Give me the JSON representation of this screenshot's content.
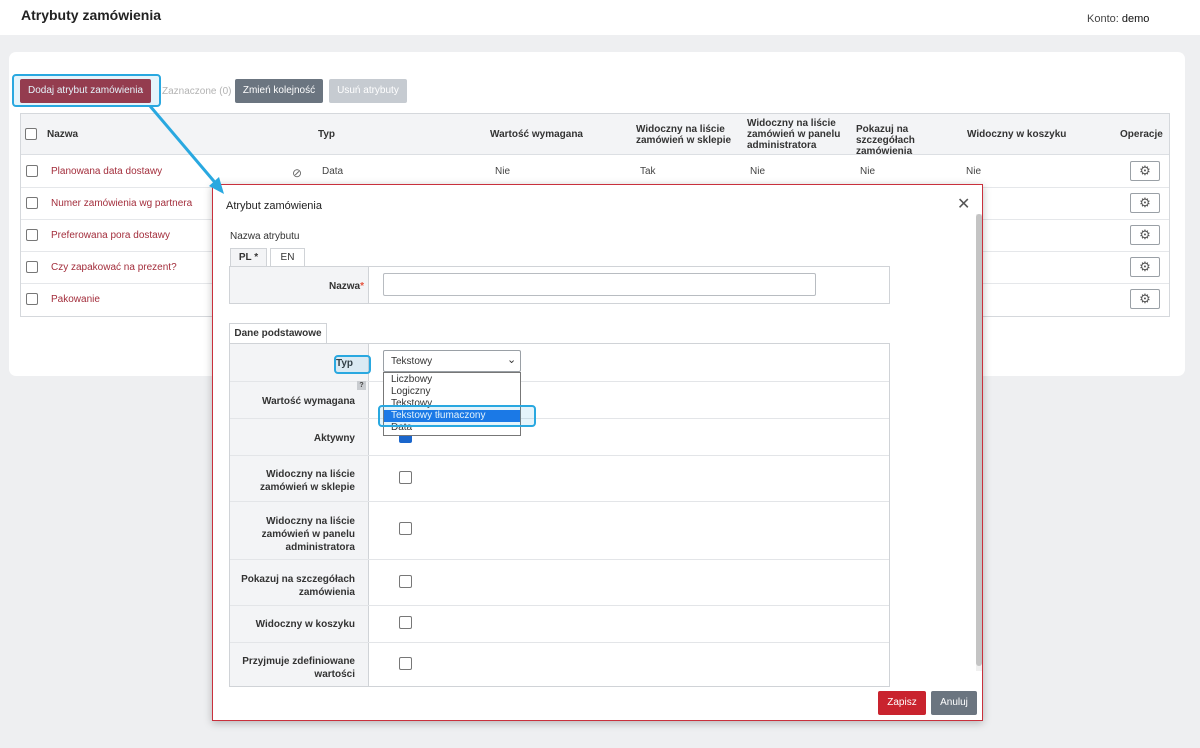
{
  "header": {
    "title": "Atrybuty zamówienia",
    "account_label": "Konto:",
    "account_value": "demo"
  },
  "toolbar": {
    "add_label": "Dodaj atrybut zamówienia",
    "selected_label": "Zaznaczone (0)",
    "reorder_label": "Zmień kolejność",
    "remove_label": "Usuń atrybuty"
  },
  "table": {
    "columns": [
      "Nazwa",
      "Typ",
      "Wartość wymagana",
      "Widoczny na liście zamówień w sklepie",
      "Widoczny na liście zamówień w panelu administratora",
      "Pokazuj na szczegółach zamówienia",
      "Widoczny w koszyku",
      "Operacje"
    ],
    "rows": [
      {
        "name": "Planowana data dostawy",
        "type": "Data",
        "required": "Nie",
        "shop_list": "Tak",
        "admin_list": "Nie",
        "details": "Nie",
        "cart": "Nie"
      },
      {
        "name": "Numer zamówienia wg partnera"
      },
      {
        "name": "Preferowana pora dostawy"
      },
      {
        "name": "Czy zapakować na prezent?"
      },
      {
        "name": "Pakowanie"
      }
    ],
    "ops_icon": "gear-icon",
    "ban_icon": "ban-icon"
  },
  "modal": {
    "title": "Atrybut zamówienia",
    "close_icon": "close-icon",
    "attr_name_label": "Nazwa atrybutu",
    "lang_tabs": [
      "PL *",
      "EN"
    ],
    "name_label": "Nazwa",
    "name_value": "",
    "section_tab": "Dane podstawowe",
    "fields": {
      "type": "Typ",
      "required": "Wartość wymagana",
      "active": "Aktywny",
      "shop_list": "Widoczny na liście zamówień w sklepie",
      "admin_list": "Widoczny na liście zamówień w panelu administratora",
      "details": "Pokazuj na szczegółach zamówienia",
      "cart": "Widoczny w koszyku",
      "predefined": "Przyjmuje zdefiniowane wartości"
    },
    "help_glyph": "?",
    "type_select": {
      "value": "Tekstowy",
      "options": [
        "Liczbowy",
        "Logiczny",
        "Tekstowy",
        "Tekstowy tłumaczony",
        "Data"
      ],
      "highlighted": "Tekstowy tłumaczony"
    },
    "active_checked": true,
    "save_label": "Zapisz",
    "cancel_label": "Anuluj"
  },
  "colors": {
    "accent": "#a32e3c",
    "highlight": "#29a8e0",
    "option_active": "#1a73e8",
    "save": "#c9232e"
  }
}
